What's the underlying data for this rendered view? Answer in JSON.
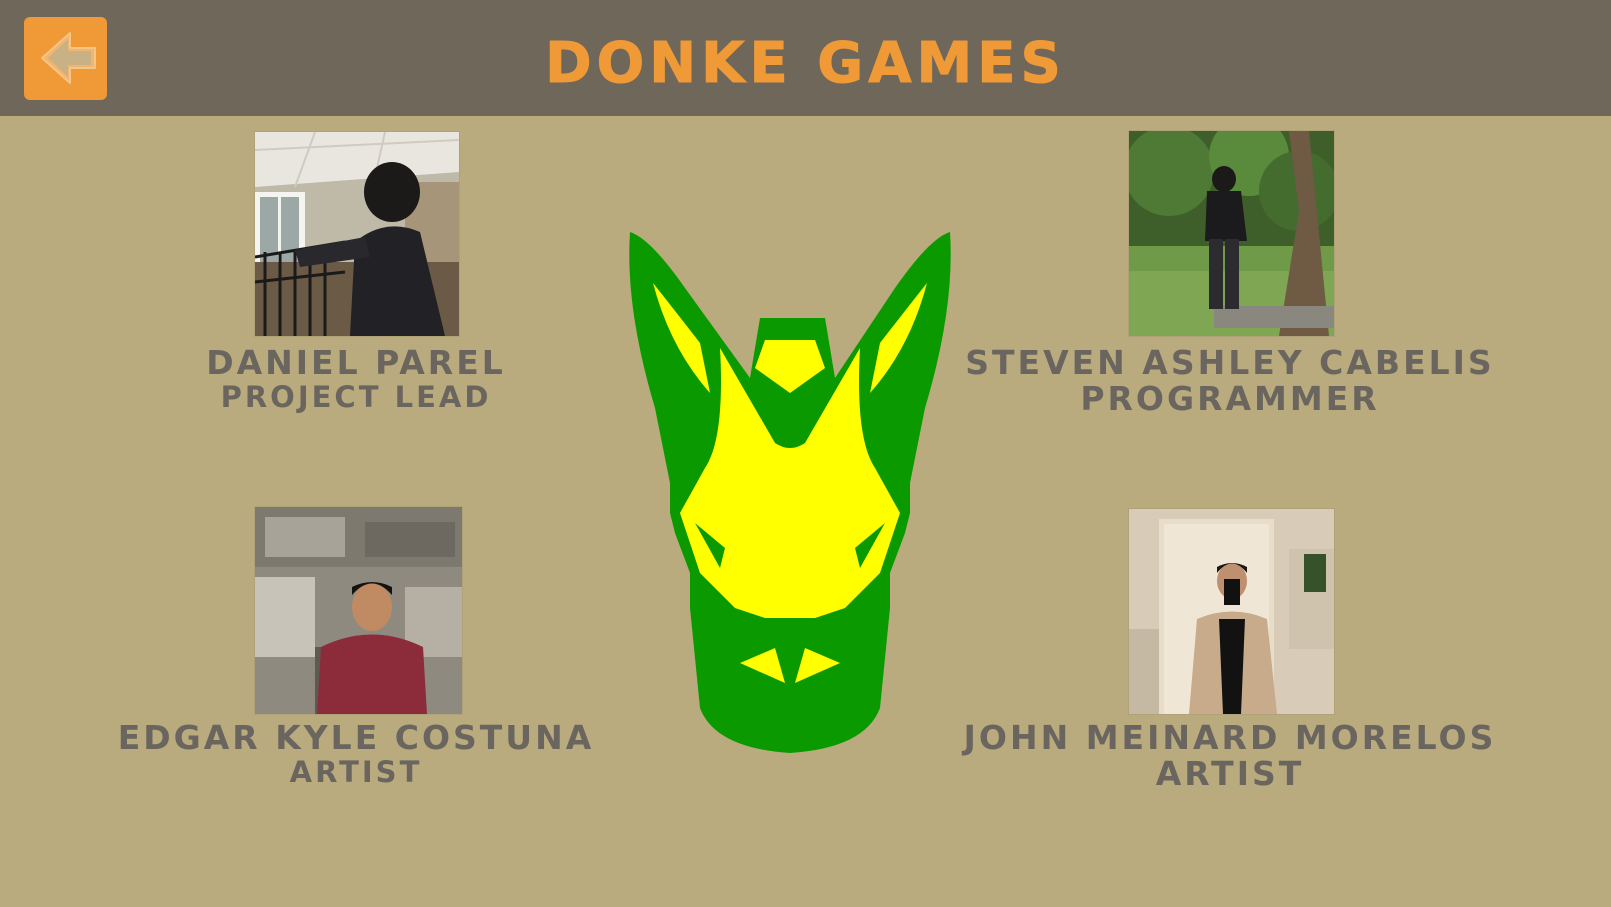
{
  "header": {
    "title": "DONKE GAMES",
    "back_icon": "arrow-left-icon"
  },
  "colors": {
    "background": "#b9ab7e",
    "header": "#6e675a",
    "accent": "#ef9a37",
    "text": "#6a665f",
    "logo_green": "#0a9a00",
    "logo_yellow": "#ffff00"
  },
  "team": [
    {
      "name": "DANIEL PAREL",
      "role": "PROJECT LEAD"
    },
    {
      "name": "STEVEN ASHLEY CABELIS",
      "role": "PROGRAMMER"
    },
    {
      "name": "EDGAR KYLE COSTUNA",
      "role": "ARTIST"
    },
    {
      "name": "JOHN MEINARD MORELOS",
      "role": "ARTIST"
    }
  ]
}
